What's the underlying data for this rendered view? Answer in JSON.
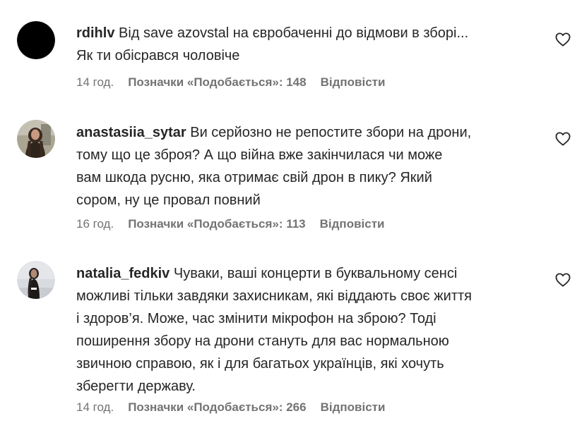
{
  "comments": [
    {
      "username": "rdihlv",
      "text": "Від save azovstal на євробаченні до відмови в зборі...\nЯк ти обісрався чоловіче",
      "time": "14 год.",
      "likes": "Позначки «Подобається»: 148",
      "reply": "Відповісти",
      "heart_icon": "heart-outline-icon"
    },
    {
      "username": "anastasiia_sytar",
      "text": "Ви серйозно не репостите збори на дрони,\nтому що це зброя? А що війна вже закінчилася чи може\nвам шкода русню, яка отримає свій дрон в пику? Який\nсором, ну це провал повний",
      "time": "16 год.",
      "likes": "Позначки «Подобається»: 113",
      "reply": "Відповісти",
      "heart_icon": "heart-outline-icon"
    },
    {
      "username": "natalia_fedkiv",
      "text": "Чуваки, ваші концерти в буквальному сенсі\nможливі тільки завдяки захисникам, які віддають своє життя\nі здоров’я. Може, час змінити мікрофон на зброю? Тоді\nпоширення збору на дрони стануть для вас нормальною\nзвичною справою, як і для багатьох українців, які хочуть\nзберегти державу.",
      "time": "14 год.",
      "likes": "Позначки «Подобається»: 266",
      "reply": "Відповісти",
      "heart_icon": "heart-outline-icon"
    }
  ]
}
